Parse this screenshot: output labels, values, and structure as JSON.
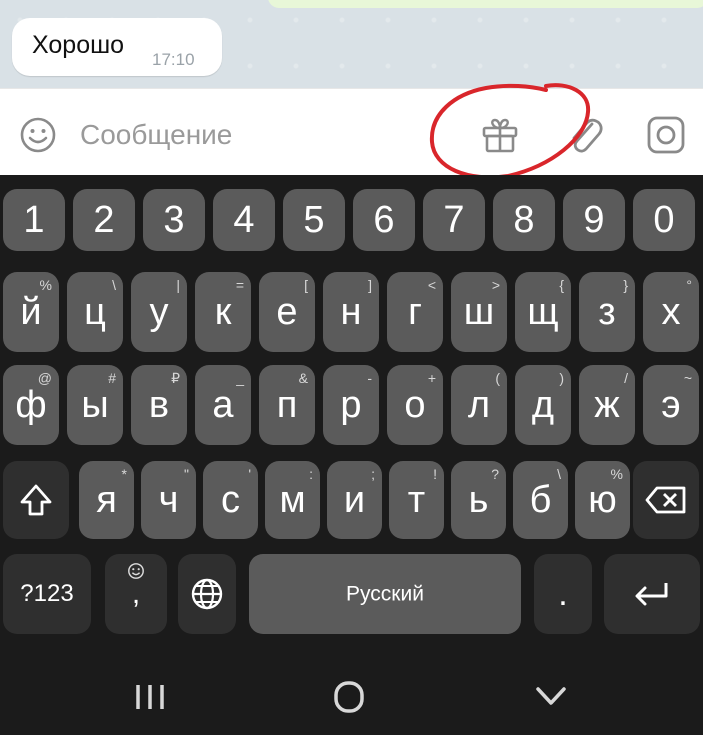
{
  "chat": {
    "message_text": "Хорошо",
    "message_time": "17:10"
  },
  "composer": {
    "placeholder": "Сообщение",
    "icons": [
      "emoji-icon",
      "gift-icon",
      "paperclip-icon",
      "camera-icon"
    ],
    "annotation_color": "#d9262b"
  },
  "keyboard": {
    "number_row": [
      "1",
      "2",
      "3",
      "4",
      "5",
      "6",
      "7",
      "8",
      "9",
      "0"
    ],
    "row1": [
      {
        "key": "й",
        "hint": "%"
      },
      {
        "key": "ц",
        "hint": "\\"
      },
      {
        "key": "у",
        "hint": "|"
      },
      {
        "key": "к",
        "hint": "="
      },
      {
        "key": "е",
        "hint": "["
      },
      {
        "key": "н",
        "hint": "]"
      },
      {
        "key": "г",
        "hint": "<"
      },
      {
        "key": "ш",
        "hint": ">"
      },
      {
        "key": "щ",
        "hint": "{"
      },
      {
        "key": "з",
        "hint": "}"
      },
      {
        "key": "х",
        "hint": "°"
      }
    ],
    "row2": [
      {
        "key": "ф",
        "hint": "@"
      },
      {
        "key": "ы",
        "hint": "#"
      },
      {
        "key": "в",
        "hint": "₽"
      },
      {
        "key": "а",
        "hint": "_"
      },
      {
        "key": "п",
        "hint": "&"
      },
      {
        "key": "р",
        "hint": "-"
      },
      {
        "key": "о",
        "hint": "+"
      },
      {
        "key": "л",
        "hint": "("
      },
      {
        "key": "д",
        "hint": ")"
      },
      {
        "key": "ж",
        "hint": "/"
      },
      {
        "key": "э",
        "hint": "~"
      }
    ],
    "row3": [
      {
        "key": "я",
        "hint": "*"
      },
      {
        "key": "ч",
        "hint": "\""
      },
      {
        "key": "с",
        "hint": "'"
      },
      {
        "key": "м",
        "hint": ":"
      },
      {
        "key": "и",
        "hint": ";"
      },
      {
        "key": "т",
        "hint": "!"
      },
      {
        "key": "ь",
        "hint": "?"
      },
      {
        "key": "б",
        "hint": "\\"
      },
      {
        "key": "ю",
        "hint": "%"
      }
    ],
    "symbols_label": "?123",
    "comma_label": ",",
    "space_label": "Русский",
    "period_label": ".",
    "key_color": "#5b5b5b",
    "dark_key_color": "#2f2f2f",
    "background_color": "#1b1b1b"
  },
  "navigation": {
    "icons": [
      "recent-apps-icon",
      "home-icon",
      "back-chevron-icon"
    ]
  }
}
